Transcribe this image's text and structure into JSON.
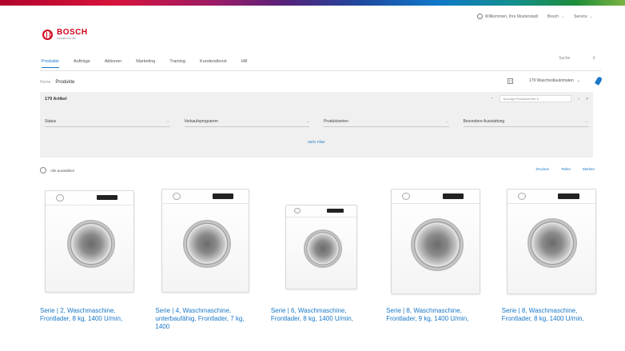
{
  "colors": {
    "brand_red": "#d0021b",
    "link_blue": "#1a78c8",
    "panel_bg": "#f0f0f0"
  },
  "top_right": {
    "account": "Willkommen, Ihre Musterstadt",
    "language": "Bosch",
    "logout": "Service"
  },
  "logo": {
    "word": "BOSCH",
    "sub": "Invented for life"
  },
  "nav": {
    "tabs": [
      "Produkte",
      "Aufträge",
      "Aktionen",
      "Marketing",
      "Training",
      "Kundendienst",
      "HR"
    ],
    "active_index": 0,
    "search_placeholder": "Suche"
  },
  "breadcrumb": {
    "home": "Home",
    "current": "Produkte"
  },
  "toolbar": {
    "filter_select": "179 Waschvollautomaten"
  },
  "filter": {
    "title": "179 Artikel",
    "search_placeholder": "Anzeige Produktreihe 6",
    "fields": [
      "Status",
      "Verkaufsprogramm",
      "Produktserien",
      "Besondere Ausstattung"
    ],
    "more": "Mehr Filter"
  },
  "actions": {
    "select_all": "Alle auswählen",
    "links": [
      "Drucken",
      "Teilen",
      "Merken"
    ]
  },
  "products": [
    {
      "title": "Serie | 2, Waschmaschine, Frontlader, 8 kg, 1400 U/min,"
    },
    {
      "title": "Serie | 4, Waschmaschine, unterbaufähig, Frontlader, 7 kg, 1400"
    },
    {
      "title": "Serie | 6, Waschmaschine, Frontlader, 8 kg, 1400 U/min,"
    },
    {
      "title": "Serie | 8, Waschmaschine, Frontlader, 9 kg, 1400 U/min,"
    },
    {
      "title": "Serie | 8, Waschmaschine, Frontlader, 8 kg, 1400 U/min,"
    }
  ]
}
